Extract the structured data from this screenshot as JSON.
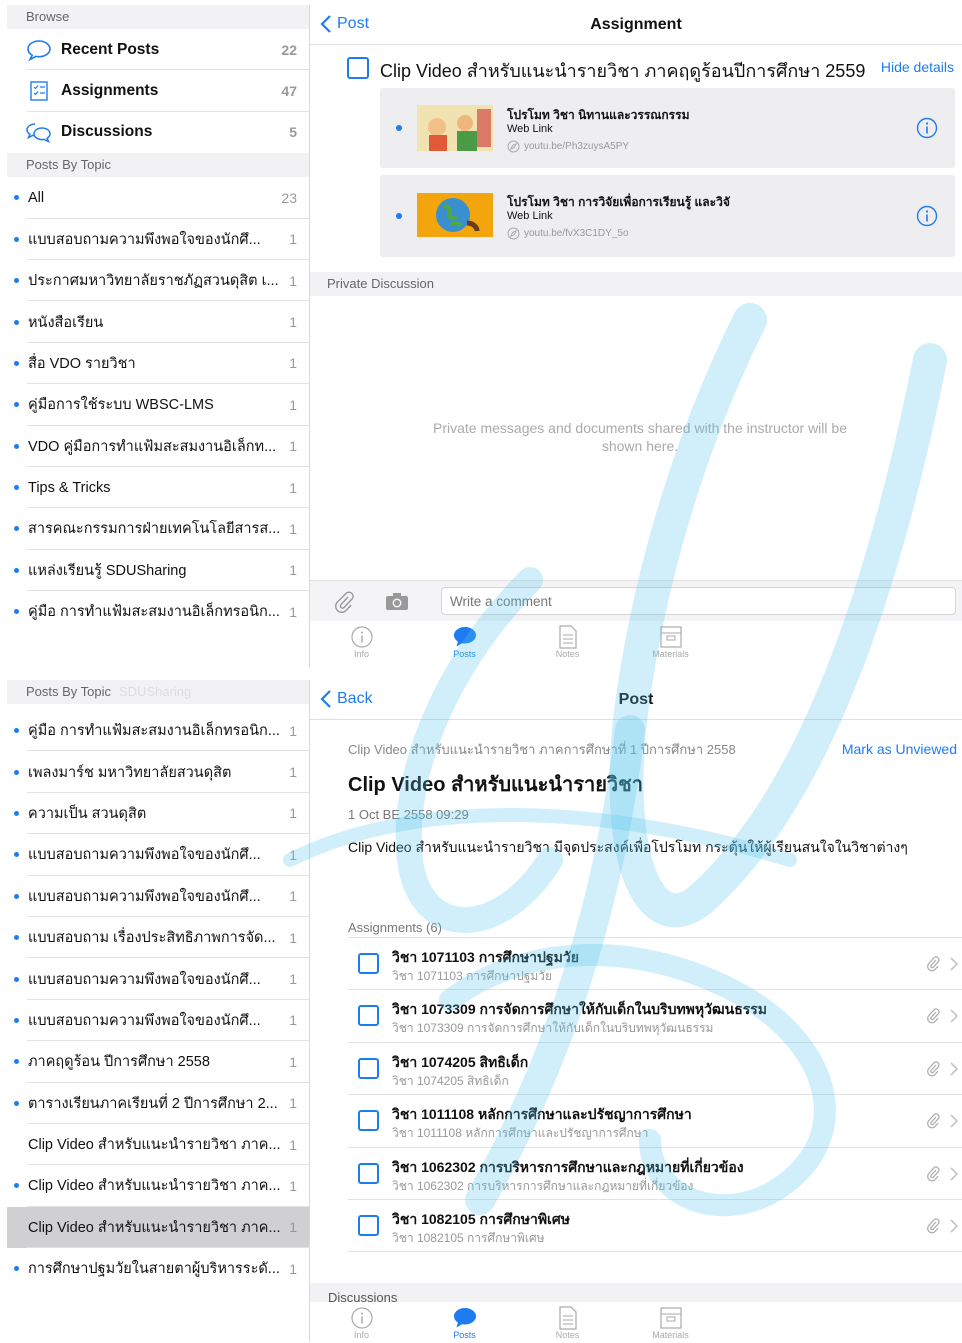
{
  "top": {
    "sidebar": {
      "browse_header": "Browse",
      "browse_items": [
        {
          "label": "Recent Posts",
          "count": "22",
          "icon": "speech-bubble-icon"
        },
        {
          "label": "Assignments",
          "count": "47",
          "icon": "checklist-icon"
        },
        {
          "label": "Discussions",
          "count": "5",
          "icon": "discussion-bubbles-icon"
        }
      ],
      "topics_header": "Posts By Topic",
      "topics": [
        {
          "label": "All",
          "count": "23"
        },
        {
          "label": "แบบสอบถามความพึงพอใจของนักศึ...",
          "count": "1"
        },
        {
          "label": "ประกาศมหาวิทยาลัยราชภัฏสวนดุสิต เ...",
          "count": "1"
        },
        {
          "label": "หนังสือเรียน",
          "count": "1"
        },
        {
          "label": "สื่อ VDO รายวิชา",
          "count": "1"
        },
        {
          "label": "คู่มือการใช้ระบบ WBSC-LMS",
          "count": "1"
        },
        {
          "label": "VDO คู่มือการทำแฟ้มสะสมงานอิเล็กท...",
          "count": "1"
        },
        {
          "label": "Tips & Tricks",
          "count": "1"
        },
        {
          "label": "สารคณะกรรมการฝ่ายเทคโนโลยีสารส...",
          "count": "1"
        },
        {
          "label": "แหล่งเรียนรู้ SDUSharing",
          "count": "1"
        },
        {
          "label": "คู่มือ การทำแฟ้มสะสมงานอิเล็กทรอนิก...",
          "count": "1"
        }
      ]
    },
    "main": {
      "back_label": "Post",
      "nav_title": "Assignment",
      "assignment_title": "Clip Video สำหรับแนะนำรายวิชา ภาคฤดูร้อนปีการศึกษา 2559",
      "hide_details": "Hide details",
      "links": [
        {
          "title": "โปรโมท วิชา นิทานและวรรณกรรม",
          "type": "Web Link",
          "url": "youtu.be/Ph3zuysA5PY"
        },
        {
          "title": "โปรโมท วิชา การวิจัยเพื่อการเรียนรู้ และวิจั",
          "type": "Web Link",
          "url": "youtu.be/fvX3C1DY_5o"
        }
      ],
      "private_header": "Private Discussion",
      "private_empty": "Private messages and documents shared with the instructor will be shown here.",
      "comment_placeholder": "Write a comment",
      "tabs": [
        "Info",
        "Posts",
        "Notes",
        "Materials"
      ]
    }
  },
  "bottom": {
    "sidebar": {
      "topics_header": "Posts By Topic",
      "topics_header_ghost": "SDUSharing",
      "topics": [
        {
          "label": "คู่มือ การทำแฟ้มสะสมงานอิเล็กทรอนิก...",
          "count": "1",
          "dot": true
        },
        {
          "label": "เพลงมาร์ช มหาวิทยาลัยสวนดุสิต",
          "count": "1",
          "dot": true
        },
        {
          "label": "ความเป็น สวนดุสิต",
          "count": "1",
          "dot": true
        },
        {
          "label": "แบบสอบถามความพึงพอใจของนักศึ...",
          "count": "1",
          "dot": true
        },
        {
          "label": "แบบสอบถามความพึงพอใจของนักศึ...",
          "count": "1",
          "dot": true
        },
        {
          "label": "แบบสอบถาม เรื่องประสิทธิภาพการจัด...",
          "count": "1",
          "dot": true
        },
        {
          "label": "แบบสอบถามความพึงพอใจของนักศึ...",
          "count": "1",
          "dot": true
        },
        {
          "label": "แบบสอบถามความพึงพอใจของนักศึ...",
          "count": "1",
          "dot": true
        },
        {
          "label": "ภาคฤดูร้อน ปีการศึกษา 2558",
          "count": "1",
          "dot": true
        },
        {
          "label": "ตารางเรียนภาคเรียนที่ 2 ปีการศึกษา 2...",
          "count": "1",
          "dot": true
        },
        {
          "label": "Clip Video สำหรับแนะนำรายวิชา ภาค...",
          "count": "1",
          "dot": false
        },
        {
          "label": "Clip Video สำหรับแนะนำรายวิชา ภาค...",
          "count": "1",
          "dot": true
        },
        {
          "label": "Clip Video สำหรับแนะนำรายวิชา ภาค...",
          "count": "1",
          "dot": false,
          "selected": true
        },
        {
          "label": "การศึกษาปฐมวัยในสายตาผู้บริหารระดั...",
          "count": "1",
          "dot": true
        }
      ]
    },
    "main": {
      "back_label": "Back",
      "nav_title": "Post",
      "topic_line": "Clip Video สำหรับแนะนำรายวิชา ภาคการศึกษาที่ 1 ปีการศึกษา 2558",
      "mark_unviewed": "Mark as Unviewed",
      "post_title": "Clip Video สำหรับแนะนำรายวิชา",
      "post_date": "1 Oct BE 2558 09:29",
      "post_body": "Clip Video สำหรับแนะนำรายวิชา มีจุดประสงค์เพื่อโปรโมท กระตุ้นให้ผู้เรียนสนใจในวิชาต่างๆ",
      "assignments_header": "Assignments (6)",
      "assignments": [
        {
          "title": "วิชา 1071103 การศึกษาปฐมวัย",
          "subtitle": "วิชา 1071103 การศึกษาปฐมวัย"
        },
        {
          "title": "วิชา 1073309 การจัดการศึกษาให้กับเด็กในบริบทพหุวัฒนธรรม",
          "subtitle": "วิชา 1073309 การจัดการศึกษาให้กับเด็กในบริบทพหุวัฒนธรรม"
        },
        {
          "title": "วิชา 1074205 สิทธิเด็ก",
          "subtitle": "วิชา 1074205 สิทธิเด็ก"
        },
        {
          "title": "วิชา 1011108 หลักการศึกษาและปรัชญาการศึกษา",
          "subtitle": "วิชา 1011108 หลักการศึกษาและปรัชญาการศึกษา"
        },
        {
          "title": "วิชา 1062302 การบริหารการศึกษาและกฎหมายที่เกี่ยวข้อง",
          "subtitle": "วิชา 1062302 การบริหารการศึกษาและกฎหมายที่เกี่ยวข้อง"
        },
        {
          "title": "วิชา 1082105 การศึกษาพิเศษ",
          "subtitle": "วิชา 1082105 การศึกษาพิเศษ"
        }
      ],
      "discussions_header": "Discussions",
      "tabs": [
        "Info",
        "Posts",
        "Notes",
        "Materials"
      ]
    }
  },
  "colors": {
    "accent": "#1e7cf0",
    "watermark": "#55c6ec",
    "selected_row": "#d0d0d3"
  }
}
